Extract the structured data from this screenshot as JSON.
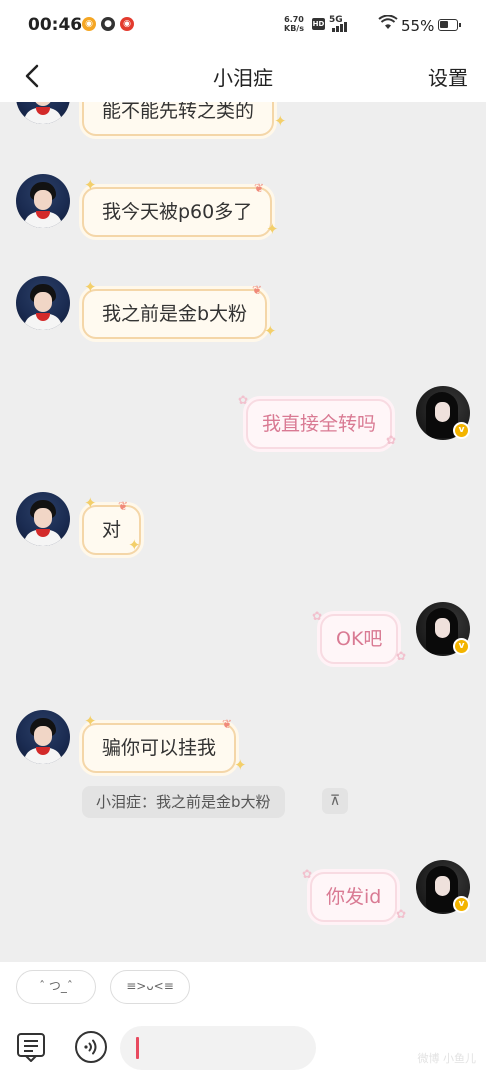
{
  "status_bar": {
    "time": "00:46",
    "net_speed_value": "6.70",
    "net_speed_unit": "KB/s",
    "hd": "HD",
    "network": "5G",
    "battery": "55%",
    "icons": [
      "weibo-app-icon",
      "wechat-icon",
      "weibo-icon",
      "signal-icon",
      "wifi-icon",
      "battery-icon"
    ]
  },
  "nav": {
    "back_icon": "chevron-left-icon",
    "title": "小泪症",
    "settings": "设置"
  },
  "messages": [
    {
      "side": "left",
      "text": "能不能先转之类的",
      "partial": true
    },
    {
      "side": "left",
      "text": "我今天被p60多了"
    },
    {
      "side": "left",
      "text": "我之前是金b大粉"
    },
    {
      "side": "right",
      "text": "我直接全转吗"
    },
    {
      "side": "left",
      "text": "对"
    },
    {
      "side": "right",
      "text": "OK吧"
    },
    {
      "side": "left",
      "text": "骗你可以挂我"
    },
    {
      "side": "right",
      "text": "你发id"
    }
  ],
  "quote": {
    "text": "小泪症：我之前是金b大粉",
    "pin_icon": "pin-top-icon"
  },
  "quick_chips": [
    "ˆ つ_ˆ",
    "≡>ᴗ<≡"
  ],
  "input": {
    "value": "",
    "left_icons": [
      "message-note-icon",
      "voice-icon"
    ]
  },
  "colors": {
    "left_bubble_border": "#f4d6a8",
    "right_bubble_text": "#d97a93",
    "badge": "#f3b400",
    "cursor": "#e84a5f"
  }
}
